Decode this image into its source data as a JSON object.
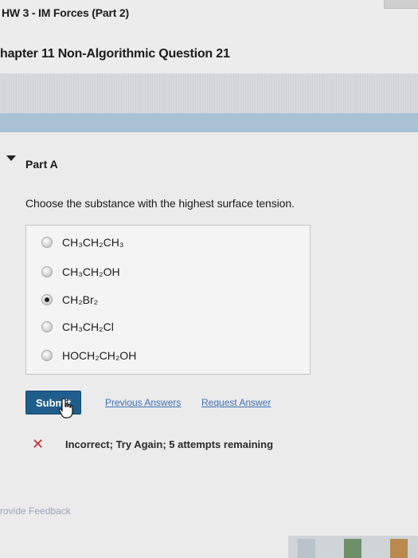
{
  "header": {
    "assignment_title": "HW 3 - IM Forces (Part 2)",
    "question_title": "hapter 11 Non-Algorithmic Question 21"
  },
  "part": {
    "label": "Part A",
    "question": "Choose the substance with the highest surface tension."
  },
  "options": [
    {
      "label": "CH₃CH₂CH₃",
      "selected": false
    },
    {
      "label": "CH₃CH₂OH",
      "selected": false
    },
    {
      "label": "CH₂Br₂",
      "selected": true
    },
    {
      "label": "CH₃CH₂Cl",
      "selected": false
    },
    {
      "label": "HOCH₂CH₂OH",
      "selected": false
    }
  ],
  "actions": {
    "submit_label": "Submit",
    "previous_answers_label": "Previous Answers",
    "request_answer_label": "Request Answer"
  },
  "feedback": {
    "status": "Incorrect; Try Again; 5 attempts remaining",
    "status_color": "#c23030"
  },
  "footer": {
    "provide_feedback_label": "rovide Feedback"
  },
  "colors": {
    "accent_bar": "#a9c1d4",
    "submit_bg": "#1f5e8c",
    "link": "#3e6fb8"
  },
  "icons": {
    "collapse": "triangle-down-icon",
    "error": "x-icon",
    "cursor": "hand-pointer-icon"
  }
}
